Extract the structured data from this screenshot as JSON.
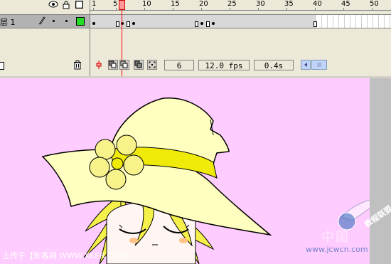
{
  "timeline": {
    "layer_name": "层 1",
    "ruler_numbers": [
      "1",
      "5",
      "10",
      "15",
      "20",
      "25",
      "30",
      "35",
      "40",
      "45",
      "50"
    ],
    "current_frame": "6",
    "fps": "12.0 fps",
    "elapsed_time": "0.4s"
  },
  "colors": {
    "stage_background": "#ffccff",
    "layer_color": "#22dd22",
    "playhead": "#ff0000"
  },
  "icons": [
    "eye-icon",
    "lock-icon",
    "outline-icon",
    "pencil-icon",
    "trash-icon",
    "onion-skin-icon",
    "onion-outline-icon",
    "edit-multiple-icon",
    "onion-markers-icon",
    "center-frame-icon",
    "scroll-left-icon"
  ],
  "watermark": {
    "uploader": "上传于【新客网 WWW.XKER.COM】",
    "site_cn": "中国",
    "site_url": "www.jcwcn.com",
    "brand": "教程联盟"
  }
}
